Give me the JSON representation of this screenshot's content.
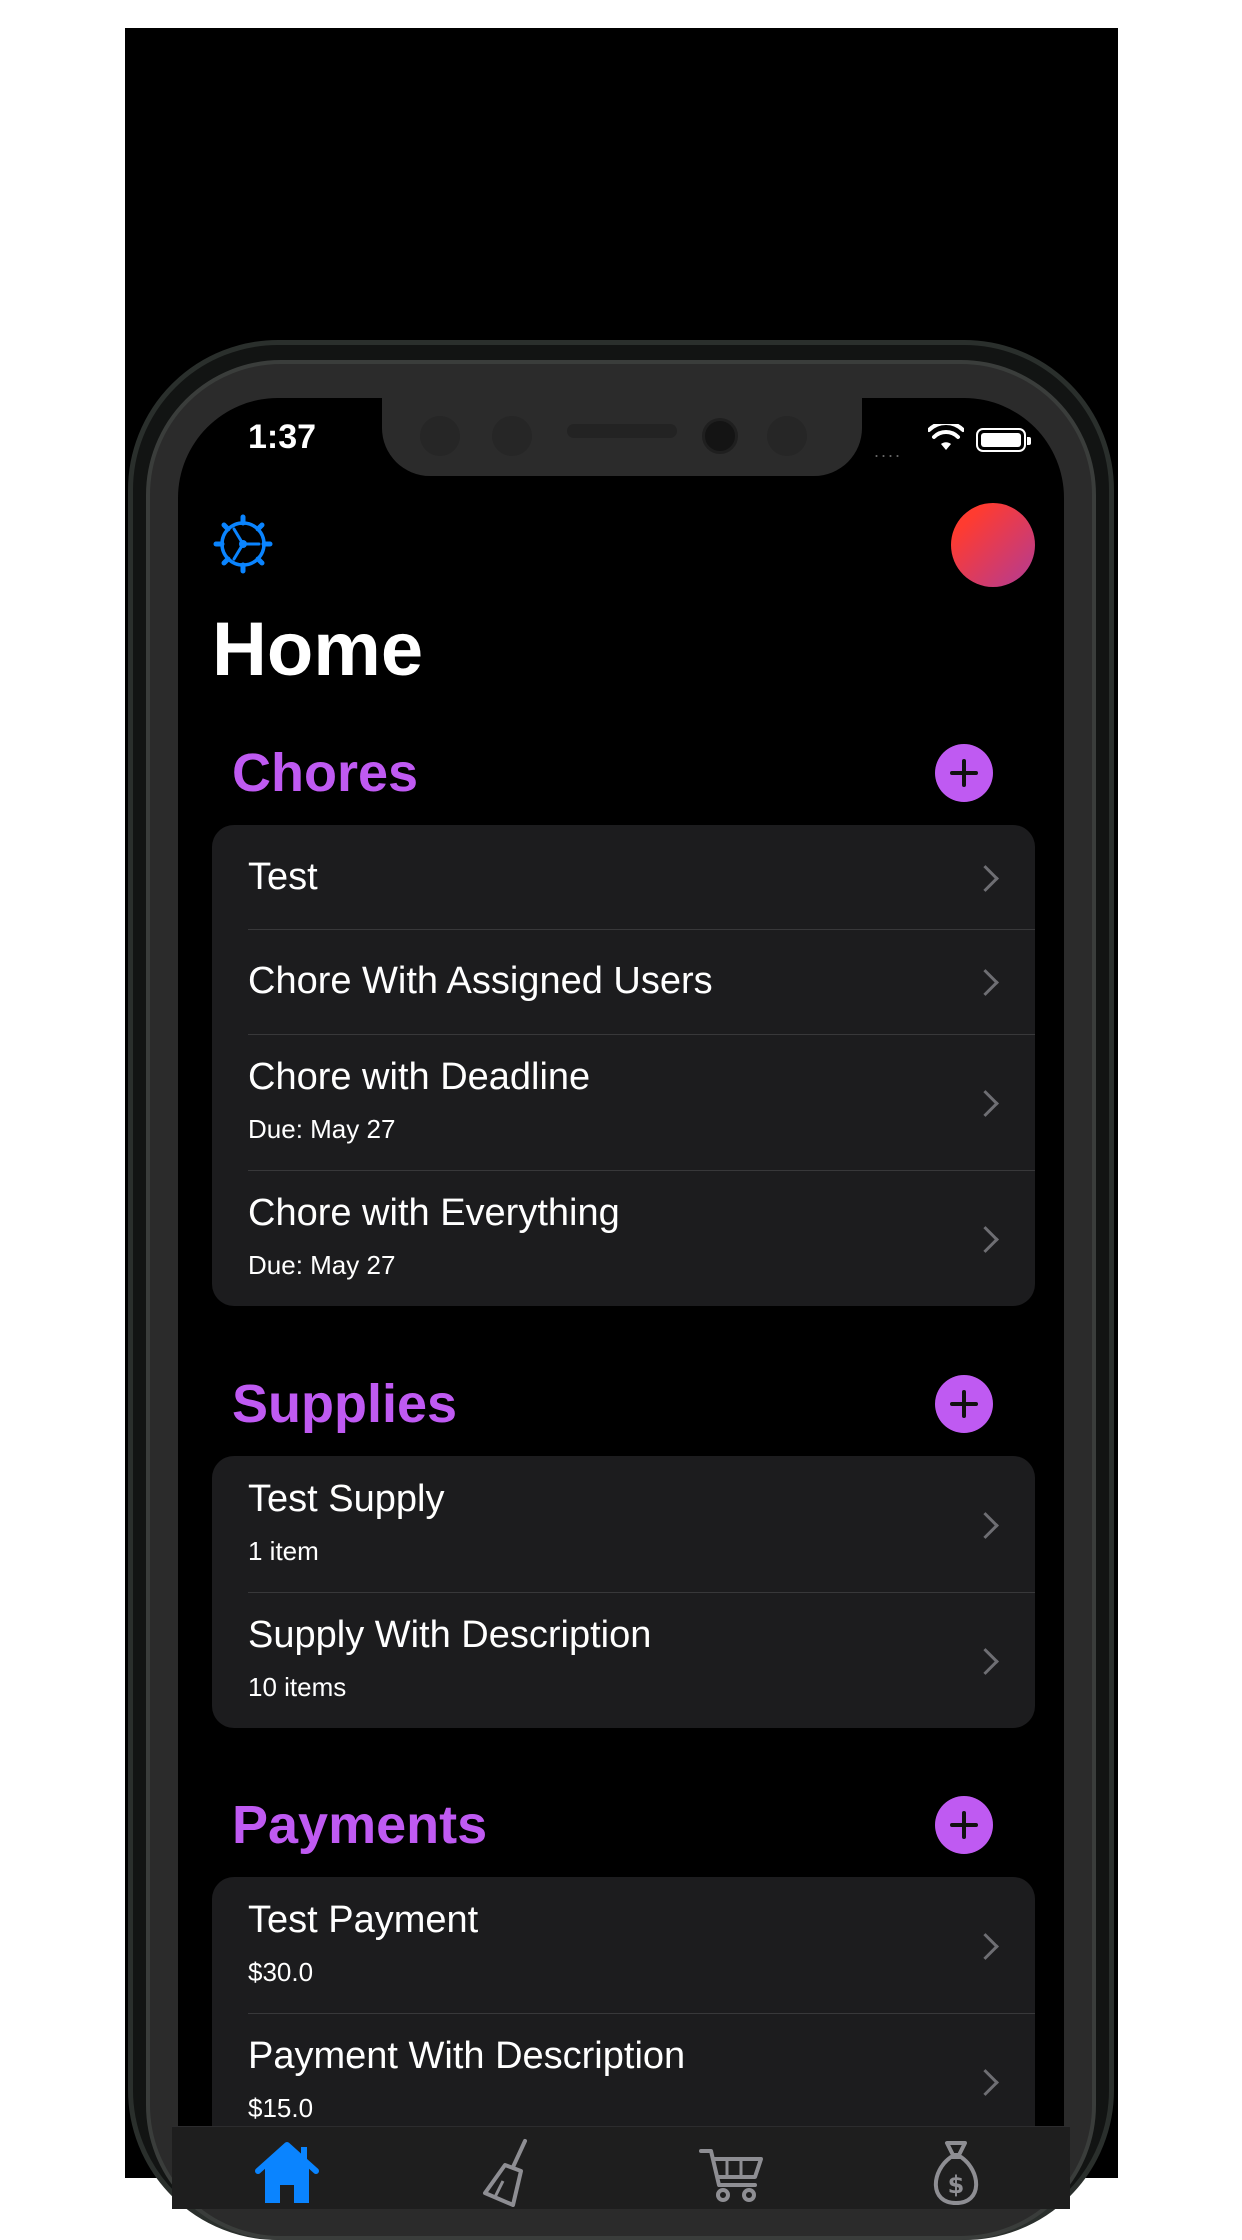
{
  "status": {
    "time": "1:37",
    "signal_dots": "....",
    "wifi": "wifi-icon",
    "battery": "battery-full"
  },
  "nav": {
    "settings_icon": "gear-icon",
    "avatar_gradient": [
      "#ff3b30",
      "#b63b8f"
    ]
  },
  "page_title": "Home",
  "accent": "#bf5af2",
  "sections": {
    "chores": {
      "title": "Chores",
      "items": [
        {
          "title": "Test"
        },
        {
          "title": "Chore With Assigned Users"
        },
        {
          "title": "Chore with Deadline",
          "subtitle": "Due: May 27"
        },
        {
          "title": "Chore with Everything",
          "subtitle": "Due: May 27"
        }
      ]
    },
    "supplies": {
      "title": "Supplies",
      "items": [
        {
          "title": "Test Supply",
          "subtitle": "1 item"
        },
        {
          "title": "Supply With Description",
          "subtitle": "10 items"
        }
      ]
    },
    "payments": {
      "title": "Payments",
      "items": [
        {
          "title": "Test Payment",
          "subtitle": "$30.0"
        },
        {
          "title": "Payment With Description",
          "subtitle": "$15.0"
        }
      ]
    }
  },
  "tabs": [
    {
      "icon": "house-icon",
      "selected": true
    },
    {
      "icon": "broom-icon",
      "selected": false
    },
    {
      "icon": "cart-icon",
      "selected": false
    },
    {
      "icon": "money-bag-icon",
      "selected": false
    }
  ],
  "colors": {
    "tab_selected": "#0a84ff",
    "tab_unselected": "#8e8e93",
    "card": "#1c1c1e"
  }
}
